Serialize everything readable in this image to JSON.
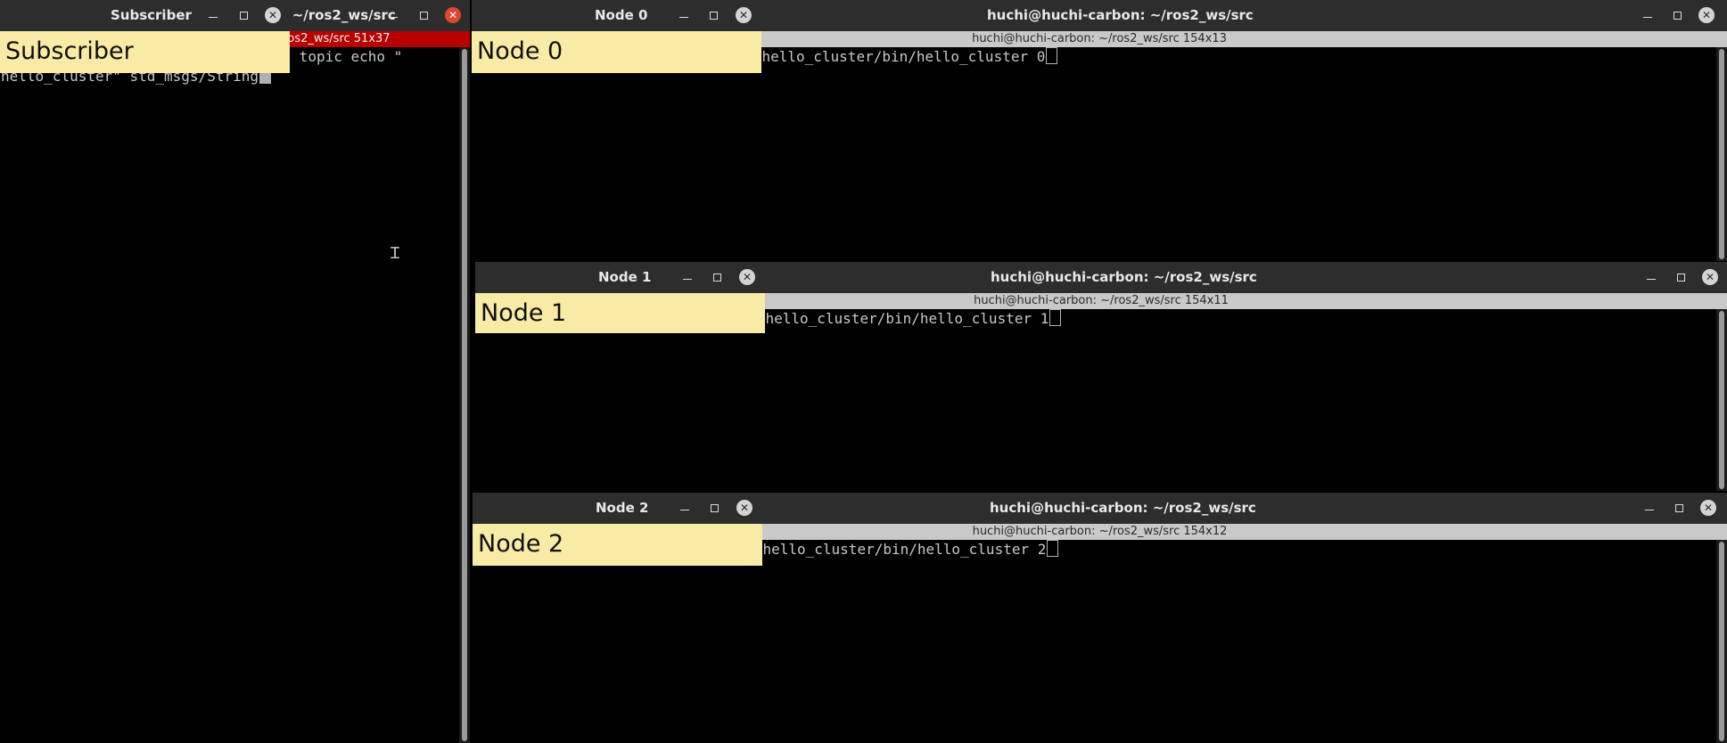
{
  "subscriber_terminal": {
    "title": "huchi@huchi-carbon: ~/ros2_ws/src",
    "size_info": "huchi@huchi-carbon: ~/ros2_ws/src 51x37",
    "lines": [
      "huchi@huchi-carbon:~/ros2_ws/src$ ros2 topic echo \"",
      "hello_cluster\" std_msgs/String"
    ]
  },
  "subscriber_label": {
    "title": "Subscriber",
    "text": "Subscriber"
  },
  "node0_terminal": {
    "title": "huchi@huchi-carbon: ~/ros2_ws/src",
    "size_info": "huchi@huchi-carbon: ~/ros2_ws/src 154x13",
    "line": "huchi@huchi-carbon:~/ros2_ws/src$ ../install/hello_cluster/bin/hello_cluster 0"
  },
  "node0_label": {
    "title": "Node 0",
    "text": "Node 0"
  },
  "node1_terminal": {
    "title": "huchi@huchi-carbon: ~/ros2_ws/src",
    "size_info": "huchi@huchi-carbon: ~/ros2_ws/src 154x11",
    "line": "huchi@huchi-carbon:~/ros2_ws/src$ ../install/hello_cluster/bin/hello_cluster 1"
  },
  "node1_label": {
    "title": "Node 1",
    "text": "Node 1"
  },
  "node2_terminal": {
    "title": "huchi@huchi-carbon: ~/ros2_ws/src",
    "size_info": "huchi@huchi-carbon: ~/ros2_ws/src 154x12",
    "line": "huchi@huchi-carbon:~/ros2_ws/src$ ../install/hello_cluster/bin/hello_cluster 2"
  },
  "node2_label": {
    "title": "Node 2",
    "text": "Node 2"
  },
  "icons": {
    "minimize": "minimize-icon",
    "maximize": "maximize-icon",
    "close": "close-icon",
    "cursor": "text-ibeam-icon"
  },
  "colors": {
    "titlebar": "#2d2d2d",
    "sticky": "#f8eba6",
    "focus_bar": "#b80000",
    "close_active": "#e0452f"
  }
}
